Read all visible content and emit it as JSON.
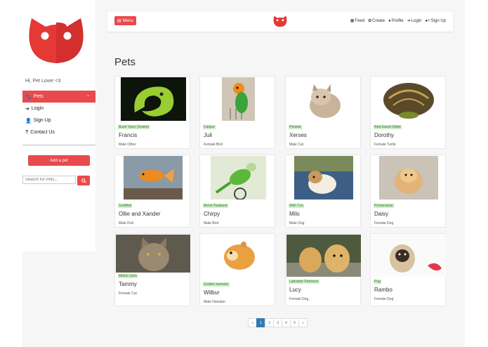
{
  "sidebar": {
    "greeting": "Hi, Pet Lover <3",
    "items": [
      {
        "label": "Pets",
        "icon": "paw-icon",
        "active": true
      },
      {
        "label": "Login",
        "icon": "login-icon"
      },
      {
        "label": "Sign Up",
        "icon": "user-plus-icon"
      },
      {
        "label": "Contact Us",
        "icon": "question-icon"
      }
    ],
    "add_pet_label": "Add a pet",
    "search_placeholder": "Search for Pets..."
  },
  "topbar": {
    "menu_label": "Menu",
    "links": [
      {
        "label": "Feed",
        "icon": "feed-icon"
      },
      {
        "label": "Create",
        "icon": "paw-icon"
      },
      {
        "label": "Profile",
        "icon": "user-icon"
      },
      {
        "label": "Login",
        "icon": "login-icon"
      },
      {
        "label": "Sign Up",
        "icon": "user-plus-icon"
      }
    ]
  },
  "page_title": "Pets",
  "pets": [
    {
      "breed": "Bush Viper (Snake)",
      "name": "Francis",
      "desc": "Male Other"
    },
    {
      "breed": "Caique",
      "name": "Juli",
      "desc": "Female Bird"
    },
    {
      "breed": "Persian",
      "name": "Xerses",
      "desc": "Male Cat"
    },
    {
      "breed": "Red Eared Slider",
      "name": "Dorothy",
      "desc": "Female Turtle"
    },
    {
      "breed": "Goldfish",
      "name": "Ollie and Xander",
      "desc": "Male Fish"
    },
    {
      "breed": "Monk Parakeet",
      "name": "Chirpy",
      "desc": "Male Bird"
    },
    {
      "breed": "Shih Tzu",
      "name": "Milo",
      "desc": "Male Dog"
    },
    {
      "breed": "Pomeranian",
      "name": "Daisy",
      "desc": "Female Dog"
    },
    {
      "breed": "Maine coon",
      "name": "Tammy",
      "desc": "Female Cat"
    },
    {
      "breed": "Golden hamster",
      "name": "Wilbur",
      "desc": "Male Hamster"
    },
    {
      "breed": "Labrador Retriever",
      "name": "Lucy",
      "desc": "Female Dog"
    },
    {
      "breed": "Pug",
      "name": "Rambo",
      "desc": "Female Dog"
    }
  ],
  "pagination": {
    "prev": "«",
    "pages": [
      "1",
      "2",
      "3",
      "4",
      "5"
    ],
    "active": "1",
    "next": "»"
  },
  "colors": {
    "accent": "#e84a4d",
    "breed_badge": "#cfeec9",
    "pager_active": "#337ab7"
  }
}
